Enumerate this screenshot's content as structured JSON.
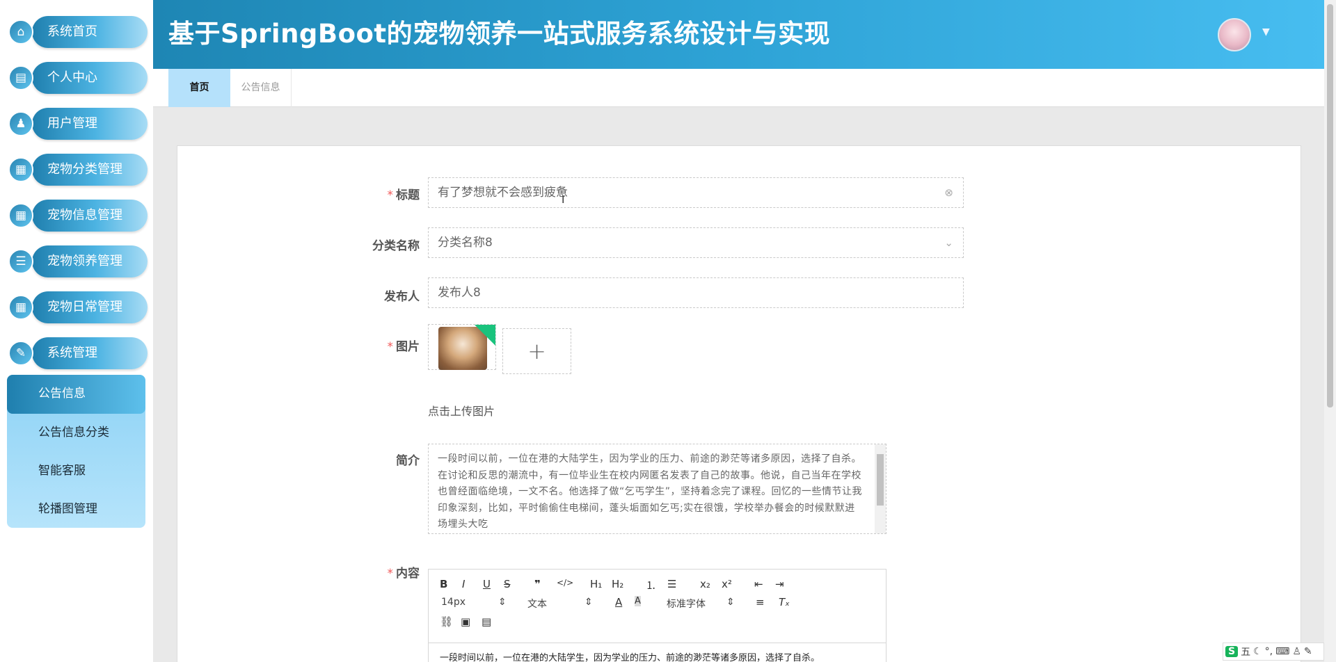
{
  "header": {
    "title": "基于SpringBoot的宠物领养一站式服务系统设计与实现"
  },
  "sidebar": {
    "items": [
      {
        "label": "系统首页",
        "icon": "home-icon",
        "glyph": "⌂"
      },
      {
        "label": "个人中心",
        "icon": "profile-icon",
        "glyph": "▤"
      },
      {
        "label": "用户管理",
        "icon": "user-icon",
        "glyph": "♟"
      },
      {
        "label": "宠物分类管理",
        "icon": "grid-icon",
        "glyph": "▦"
      },
      {
        "label": "宠物信息管理",
        "icon": "grid-icon",
        "glyph": "▦"
      },
      {
        "label": "宠物领养管理",
        "icon": "list-icon",
        "glyph": "☰"
      },
      {
        "label": "宠物日常管理",
        "icon": "grid-icon",
        "glyph": "▦"
      },
      {
        "label": "系统管理",
        "icon": "settings-icon",
        "glyph": "✎"
      }
    ],
    "submenu": [
      "公告信息",
      "公告信息分类",
      "智能客服",
      "轮播图管理"
    ]
  },
  "tabs": {
    "home": "首页",
    "notice": "公告信息"
  },
  "form": {
    "title_label": "标题",
    "title_value": "有了梦想就不会感到疲惫",
    "category_label": "分类名称",
    "category_value": "分类名称8",
    "publisher_label": "发布人",
    "publisher_value": "发布人8",
    "image_label": "图片",
    "upload_hint": "点击上传图片",
    "intro_label": "简介",
    "intro_value": "一段时间以前，一位在港的大陆学生，因为学业的压力、前途的渺茫等诸多原因，选择了自杀。在讨论和反思的潮流中，有一位毕业生在校内网匿名发表了自己的故事。他说，自己当年在学校也曾经面临绝境，一文不名。他选择了做“乞丐学生”，坚持着念完了课程。回忆的一些情节让我印象深刻，比如，平时偷偷住电梯间，蓬头垢面如乞丐;实在很饿，学校举办餐会的时候默默进场埋头大吃",
    "content_label": "内容",
    "content_value": "一段时间以前，一位在港的大陆学生，因为学业的压力、前途的渺茫等诸多原因，选择了自杀。"
  },
  "editor": {
    "font_size": "14px",
    "format": "文本",
    "font_family": "标准字体"
  },
  "ime": {
    "mode": "五"
  }
}
